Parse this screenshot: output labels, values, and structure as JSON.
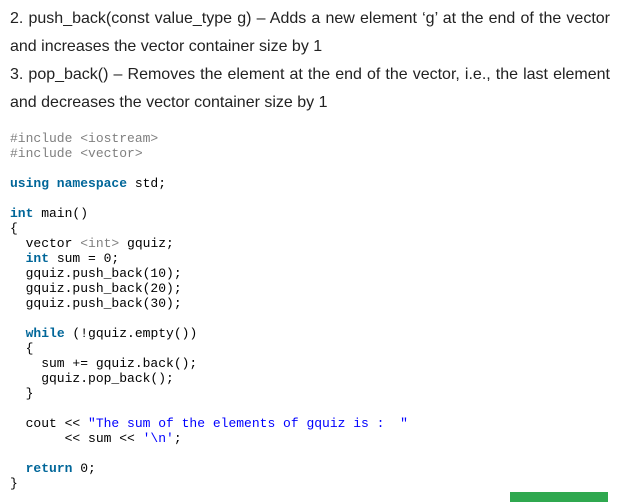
{
  "paragraphs": [
    "2. push_back(const value_type g) – Adds a new element ‘g’ at the end of the vector and increases the vector container size by 1",
    "3. pop_back() – Removes the element at the end of the vector, i.e., the last element and decreases the vector container size by 1"
  ],
  "code_lines": [
    [
      [
        "#include <iostream>",
        "pp"
      ]
    ],
    [
      [
        "#include <vector>",
        "pp"
      ]
    ],
    [],
    [
      [
        "using namespace",
        "kw"
      ],
      [
        " std;",
        ""
      ]
    ],
    [],
    [
      [
        "int",
        "kw"
      ],
      [
        " main()",
        ""
      ]
    ],
    [
      [
        "{",
        ""
      ]
    ],
    [
      [
        "  vector ",
        ""
      ],
      [
        "<int>",
        "typ"
      ],
      [
        " gquiz;",
        ""
      ]
    ],
    [
      [
        "  ",
        ""
      ],
      [
        "int",
        "kw"
      ],
      [
        " sum = 0;",
        ""
      ]
    ],
    [
      [
        "  gquiz.push_back(10);",
        ""
      ]
    ],
    [
      [
        "  gquiz.push_back(20);",
        ""
      ]
    ],
    [
      [
        "  gquiz.push_back(30);",
        ""
      ]
    ],
    [],
    [
      [
        "  ",
        ""
      ],
      [
        "while",
        "kw"
      ],
      [
        " (!gquiz.empty())",
        ""
      ]
    ],
    [
      [
        "  {",
        ""
      ]
    ],
    [
      [
        "    sum += gquiz.back();",
        ""
      ]
    ],
    [
      [
        "    gquiz.pop_back();",
        ""
      ]
    ],
    [
      [
        "  }",
        ""
      ]
    ],
    [],
    [
      [
        "  cout << ",
        ""
      ],
      [
        "\"The sum of the elements of gquiz is :  \"",
        "str"
      ]
    ],
    [
      [
        "       << sum << ",
        ""
      ],
      [
        "'\\n'",
        "str"
      ],
      [
        ";",
        ""
      ]
    ],
    [],
    [
      [
        "  ",
        ""
      ],
      [
        "return",
        "kw"
      ],
      [
        " 0;",
        ""
      ]
    ],
    [
      [
        "}",
        ""
      ]
    ]
  ],
  "accent_color": "#2fa84f"
}
